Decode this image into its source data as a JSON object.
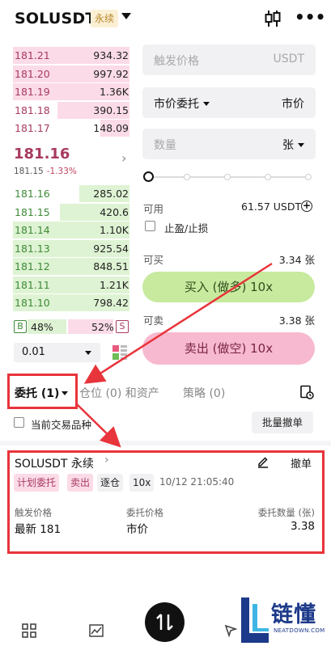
{
  "header": {
    "symbol": "SOLUSDT",
    "perp_tag": "永续"
  },
  "order_book": {
    "asks": [
      {
        "price": "181.21",
        "qty": "934.32",
        "depth": 1.0
      },
      {
        "price": "181.20",
        "qty": "997.92",
        "depth": 1.0
      },
      {
        "price": "181.19",
        "qty": "1.36K",
        "depth": 1.0
      },
      {
        "price": "181.18",
        "qty": "390.15",
        "depth": 0.62
      },
      {
        "price": "181.17",
        "qty": "148.09",
        "depth": 0.25
      }
    ],
    "last_price": "181.16",
    "mark_price": "181.15",
    "change": "-1.33%",
    "bids": [
      {
        "price": "181.16",
        "qty": "285.02",
        "depth": 0.43
      },
      {
        "price": "181.15",
        "qty": "420.6",
        "depth": 0.6
      },
      {
        "price": "181.14",
        "qty": "1.10K",
        "depth": 1.0
      },
      {
        "price": "181.13",
        "qty": "925.54",
        "depth": 1.0
      },
      {
        "price": "181.12",
        "qty": "848.51",
        "depth": 1.0
      },
      {
        "price": "181.11",
        "qty": "1.21K",
        "depth": 1.0
      },
      {
        "price": "181.10",
        "qty": "798.42",
        "depth": 1.0
      }
    ],
    "buy_ratio_label": "B",
    "buy_ratio": "48%",
    "sell_ratio": "52%",
    "sell_ratio_label": "S",
    "depth_value": "0.01"
  },
  "form": {
    "trigger_price_placeholder": "触发价格",
    "trigger_unit": "USDT",
    "order_type": "市价委托",
    "price_mode": "市价",
    "quantity_placeholder": "数量",
    "quantity_unit": "张",
    "available_label": "可用",
    "available_value": "61.57 USDT",
    "tpsl_label": "止盈/止损",
    "can_buy_label": "可买",
    "can_buy_value": "3.34 张",
    "buy_button": "买入 (做多) 10x",
    "can_sell_label": "可卖",
    "can_sell_value": "3.38 张",
    "sell_button": "卖出 (做空) 10x"
  },
  "tabs": {
    "orders": "委托 (1)",
    "positions": "仓位 (0) 和资产",
    "strategies": "策略 (0)"
  },
  "filters": {
    "only_current_label": "当前交易品种",
    "batch_cancel": "批量撤单"
  },
  "order": {
    "symbol": "SOLUSDT 永续",
    "cancel": "撤单",
    "badges": [
      "计划委托",
      "卖出",
      "逐仓",
      "10x"
    ],
    "time": "10/12 21:05:40",
    "trigger_label": "触发价格",
    "trigger_value": "最新 181",
    "order_price_label": "委托价格",
    "order_price_value": "市价",
    "order_qty_label": "委托数量 (张)",
    "order_qty_value": "3.38"
  },
  "watermark": {
    "text": "链懂",
    "sub": "NEATDOWN.COM"
  },
  "colors": {
    "ask": "#a83a61",
    "bid": "#3e8a38",
    "highlight": "#e8343b",
    "buy_button": "#c7ea9e",
    "sell_button": "#f7b9cf"
  }
}
